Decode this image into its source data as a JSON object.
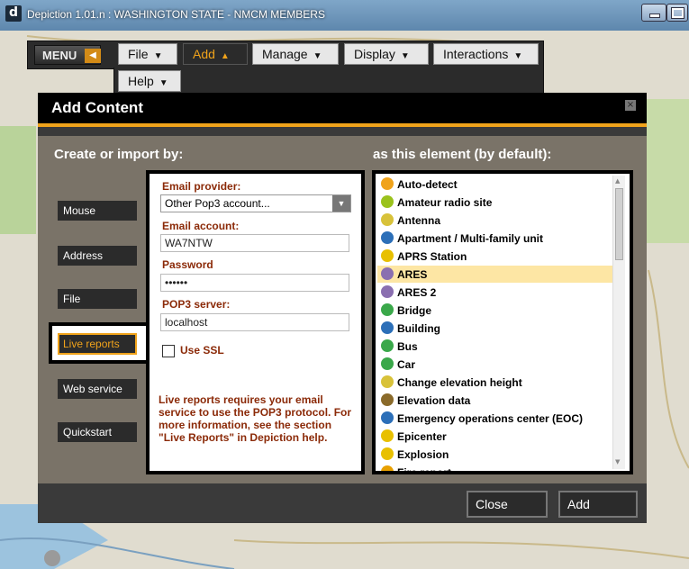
{
  "window": {
    "title": "Depiction 1.01.n : WASHINGTON STATE - NMCM MEMBERS",
    "logo_letter": "d"
  },
  "menu": {
    "menu_label": "MENU",
    "items": [
      {
        "label": "File",
        "caret": "▼"
      },
      {
        "label": "Add",
        "caret": "▲"
      },
      {
        "label": "Manage",
        "caret": "▼"
      },
      {
        "label": "Display",
        "caret": "▼"
      },
      {
        "label": "Interactions",
        "caret": "▼"
      },
      {
        "label": "Help",
        "caret": "▼"
      }
    ]
  },
  "dialog": {
    "title": "Add Content",
    "close_glyph": "×",
    "create_heading": "Create or import by:",
    "element_heading": "as this element (by default):",
    "sources": [
      "Mouse",
      "Address",
      "File",
      "Live reports",
      "Web service",
      "Quickstart"
    ],
    "form": {
      "provider_label": "Email provider:",
      "provider_value": "Other Pop3 account...",
      "account_label": "Email account:",
      "account_value": "WA7NTW",
      "password_label": "Password",
      "password_value": "••••••",
      "server_label": "POP3 server:",
      "server_value": "localhost",
      "ssl_label": "Use SSL",
      "info": "Live reports requires your email service to use the POP3 protocol. For more information, see the section \"Live Reports\" in Depiction help."
    },
    "elements": [
      {
        "label": "Auto-detect",
        "icon": "orange-dot-icon",
        "color": "#f0a31b"
      },
      {
        "label": "Amateur radio site",
        "icon": "radio-tower-icon",
        "color": "#9ac21c"
      },
      {
        "label": "Antenna",
        "icon": "antenna-icon",
        "color": "#d8c23a"
      },
      {
        "label": "Apartment / Multi-family unit",
        "icon": "apartment-icon",
        "color": "#2c6fb8"
      },
      {
        "label": "APRS Station",
        "icon": "aprs-icon",
        "color": "#e8c000"
      },
      {
        "label": "ARES",
        "icon": "ares-icon",
        "color": "#8a6fb0"
      },
      {
        "label": "ARES 2",
        "icon": "ares-icon",
        "color": "#8a6fb0"
      },
      {
        "label": "Bridge",
        "icon": "bridge-icon",
        "color": "#3aa84a"
      },
      {
        "label": "Building",
        "icon": "building-icon",
        "color": "#2c6fb8"
      },
      {
        "label": "Bus",
        "icon": "bus-icon",
        "color": "#3aa84a"
      },
      {
        "label": "Car",
        "icon": "car-icon",
        "color": "#3aa84a"
      },
      {
        "label": "Change elevation height",
        "icon": "elevation-icon",
        "color": "#d8c23a"
      },
      {
        "label": "Elevation data",
        "icon": "elevation-data-icon",
        "color": "#8a6a2a"
      },
      {
        "label": "Emergency operations center (EOC)",
        "icon": "eoc-icon",
        "color": "#2c6fb8"
      },
      {
        "label": "Epicenter",
        "icon": "epicenter-icon",
        "color": "#e8c000"
      },
      {
        "label": "Explosion",
        "icon": "explosion-icon",
        "color": "#e8c000"
      },
      {
        "label": "Fire report",
        "icon": "fire-icon",
        "color": "#e8a000"
      }
    ],
    "selected_element": "ARES",
    "close_label": "Close",
    "add_label": "Add"
  },
  "colors": {
    "accent": "#f0a31b",
    "form_text": "#8b2a08"
  }
}
